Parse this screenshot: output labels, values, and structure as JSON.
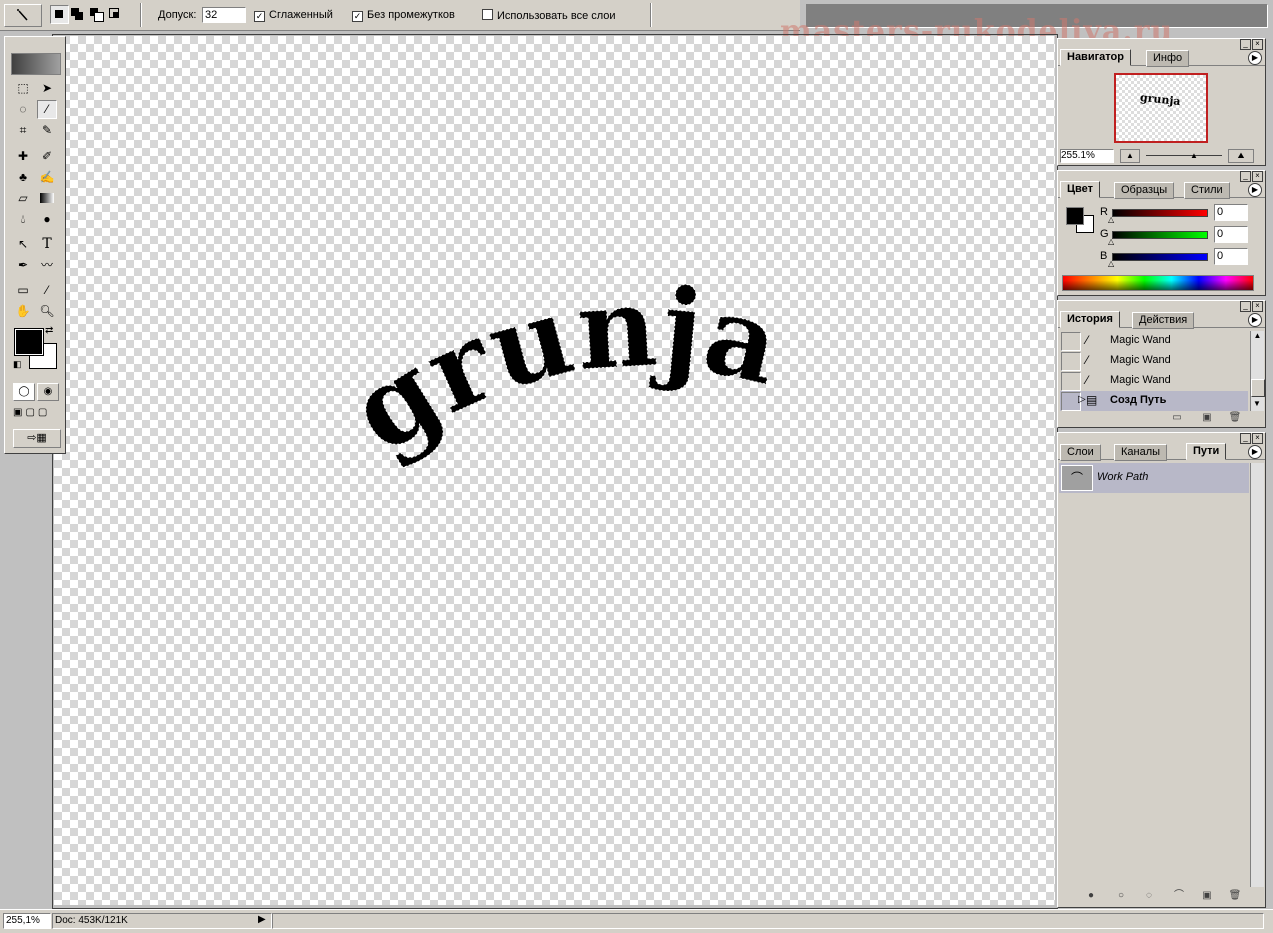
{
  "options_bar": {
    "tolerance_label": "Допуск:",
    "tolerance_value": "32",
    "antialias_label": "Сглаженный",
    "antialias_checked": "✓",
    "contiguous_label": "Без промежутков",
    "contiguous_checked": "✓",
    "all_layers_label": "Использовать все слои"
  },
  "watermark": "masters-rukodeliya.ru",
  "canvas": {
    "text": "grunja"
  },
  "navigator": {
    "tabs": [
      "Навигатор",
      "Инфо"
    ],
    "zoom_value": "255.1%",
    "thumb_text": "grunja"
  },
  "color": {
    "tabs": [
      "Цвет",
      "Образцы",
      "Стили"
    ],
    "channels": [
      {
        "label": "R",
        "value": "0",
        "color": "#c00000"
      },
      {
        "label": "G",
        "value": "0",
        "color": "#00a000"
      },
      {
        "label": "B",
        "value": "0",
        "color": "#0000c0"
      }
    ]
  },
  "history": {
    "tabs": [
      "История",
      "Действия"
    ],
    "items": [
      {
        "label": "Magic Wand",
        "icon": "magic-wand-icon"
      },
      {
        "label": "Magic Wand",
        "icon": "magic-wand-icon"
      },
      {
        "label": "Magic Wand",
        "icon": "magic-wand-icon"
      },
      {
        "label": "Созд Путь",
        "icon": "path-icon",
        "selected": true
      }
    ]
  },
  "paths": {
    "tabs": [
      "Слои",
      "Каналы",
      "Пути"
    ],
    "items": [
      {
        "label": "Work Path"
      }
    ]
  },
  "status": {
    "zoom": "255,1%",
    "doc": "Doc: 453K/121K"
  }
}
